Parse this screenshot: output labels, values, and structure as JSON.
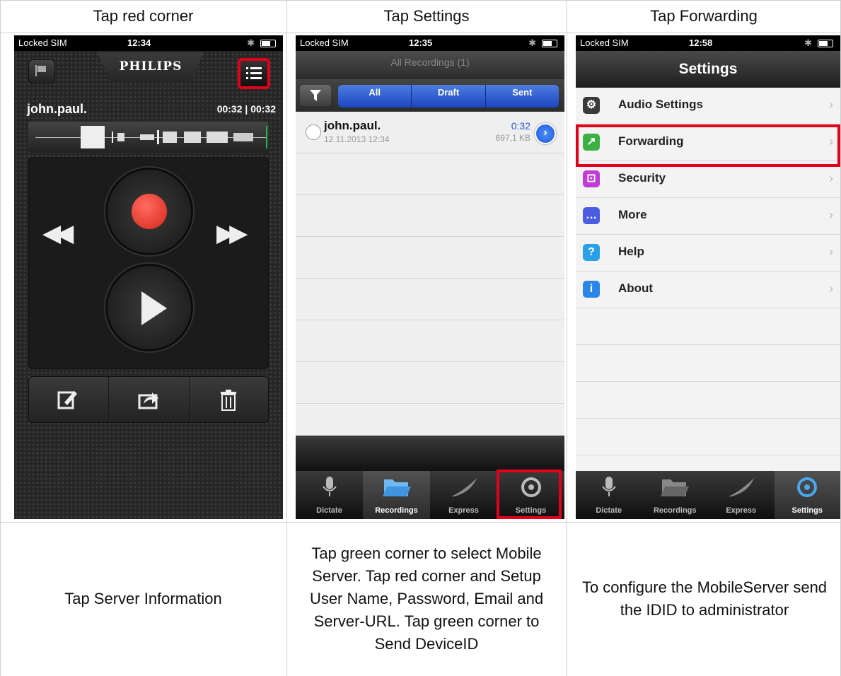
{
  "captions": {
    "c1": "Tap red corner",
    "c2": "Tap Settings",
    "c3": "Tap Forwarding",
    "b1": "Tap Server Information",
    "b2": "Tap green corner to select Mobile Server. Tap red corner and Setup User Name, Password, Email and Server-URL. Tap green corner to Send DeviceID",
    "b3": "To configure the MobileServer send the IDID to administrator"
  },
  "status": {
    "carrier": "Locked SIM",
    "t1": "12:34",
    "t2": "12:35",
    "t3": "12:58"
  },
  "recorder": {
    "brand": "PHILIPS",
    "name": "john.paul.",
    "time": "00:32 | 00:32",
    "icons": [
      "flag-icon",
      "list-icon",
      "record-icon",
      "play-icon",
      "rewind-icon",
      "fast-forward-icon",
      "edit-icon",
      "share-icon",
      "trash-icon"
    ]
  },
  "recordings": {
    "title": "All Recordings (1)",
    "segments": [
      "All",
      "Draft",
      "Sent"
    ],
    "items": [
      {
        "name": "john.paul.",
        "date": "12.11.2013 12:34",
        "duration": "0:32",
        "size": "697,1 KB"
      }
    ]
  },
  "tabs": [
    "Dictate",
    "Recordings",
    "Express",
    "Settings"
  ],
  "settings": {
    "title": "Settings",
    "items": [
      {
        "label": "Audio Settings",
        "icon": "gear-icon",
        "color": "#3a3a3a"
      },
      {
        "label": "Forwarding",
        "icon": "forward-icon",
        "color": "#3cb043"
      },
      {
        "label": "Security",
        "icon": "lock-icon",
        "color": "#c13bd6"
      },
      {
        "label": "More",
        "icon": "more-icon",
        "color": "#4a5de0"
      },
      {
        "label": "Help",
        "icon": "help-icon",
        "color": "#2aa0e8"
      },
      {
        "label": "About",
        "icon": "info-icon",
        "color": "#2a86e8"
      }
    ]
  },
  "colors": {
    "highlight": "#e3001b",
    "accent": "#2356d8"
  }
}
